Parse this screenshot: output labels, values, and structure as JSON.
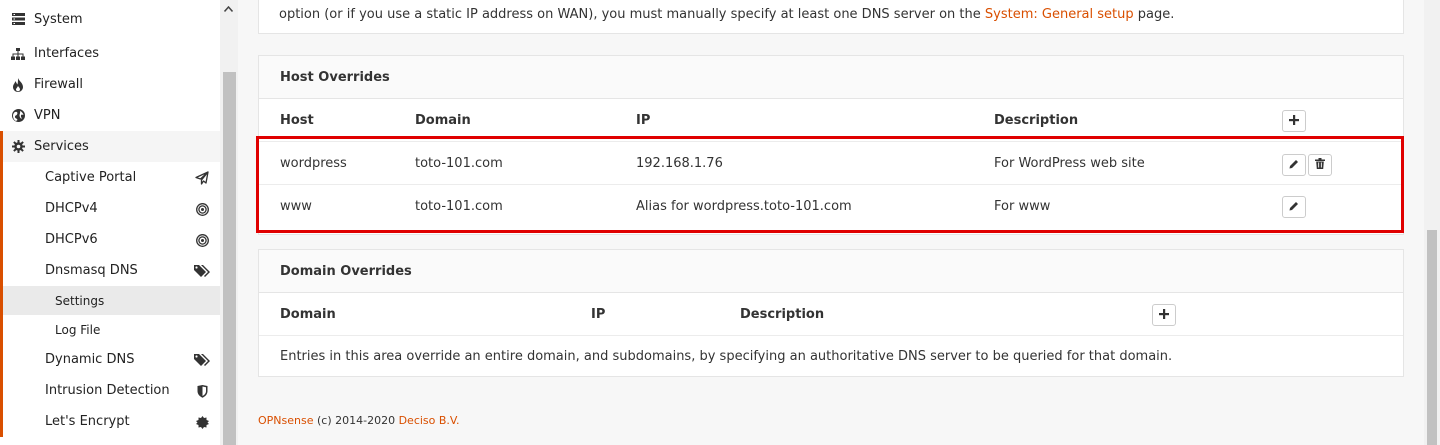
{
  "sidebar": {
    "top_items": [
      {
        "label": "System",
        "icon": "server-icon"
      },
      {
        "label": "Interfaces",
        "icon": "sitemap-icon"
      },
      {
        "label": "Firewall",
        "icon": "fire-icon"
      },
      {
        "label": "VPN",
        "icon": "globe-icon"
      },
      {
        "label": "Services",
        "icon": "gear-icon"
      }
    ],
    "services": [
      {
        "label": "Captive Portal",
        "icon": "paper-plane-icon"
      },
      {
        "label": "DHCPv4",
        "icon": "bullseye-icon"
      },
      {
        "label": "DHCPv6",
        "icon": "bullseye-icon"
      },
      {
        "label": "Dnsmasq DNS",
        "icon": "tags-icon"
      }
    ],
    "dnsmasq_sub": [
      {
        "label": "Settings"
      },
      {
        "label": "Log File"
      }
    ],
    "services_more": [
      {
        "label": "Dynamic DNS",
        "icon": "tags-icon"
      },
      {
        "label": "Intrusion Detection",
        "icon": "shield-icon"
      },
      {
        "label": "Let's Encrypt",
        "icon": "certificate-icon"
      }
    ]
  },
  "top_note": {
    "text_before": "option (or if you use a static IP address on WAN), you must manually specify at least one DNS server on the ",
    "link": "System: General setup",
    "text_after": " page."
  },
  "host_overrides": {
    "title": "Host Overrides",
    "columns": [
      "Host",
      "Domain",
      "IP",
      "Description"
    ],
    "rows": [
      {
        "host": "wordpress",
        "domain": "toto-101.com",
        "ip": "192.168.1.76",
        "description": "For WordPress web site"
      },
      {
        "host": "www",
        "domain": "toto-101.com",
        "ip": "Alias for wordpress.toto-101.com",
        "description": "For www"
      }
    ]
  },
  "domain_overrides": {
    "title": "Domain Overrides",
    "columns": [
      "Domain",
      "IP",
      "Description"
    ],
    "note": "Entries in this area override an entire domain, and subdomains, by specifying an authoritative DNS server to be queried for that domain."
  },
  "footer": {
    "brand": "OPNsense",
    "copyright": " (c) 2014-2020 ",
    "company": "Deciso B.V."
  },
  "colors": {
    "accent": "#d94f00",
    "highlight": "#e00000"
  }
}
